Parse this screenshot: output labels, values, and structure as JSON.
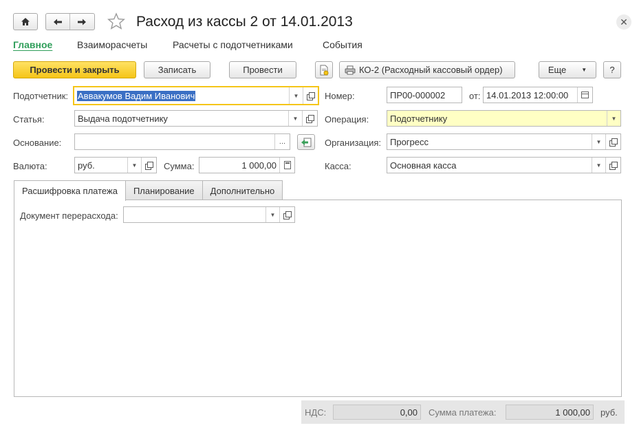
{
  "header": {
    "title": "Расход из кассы 2 от 14.01.2013"
  },
  "nav_tabs": [
    {
      "label": "Главное"
    },
    {
      "label": "Взаиморасчеты"
    },
    {
      "label": "Расчеты с подотчетниками"
    },
    {
      "label": "События"
    }
  ],
  "toolbar": {
    "post_close": "Провести и закрыть",
    "save": "Записать",
    "post": "Провести",
    "print": "КО-2 (Расходный кассовый ордер)",
    "more": "Еще",
    "help": "?"
  },
  "form": {
    "employee_label": "Подотчетник:",
    "employee_value": "Аввакумов Вадим Иванович",
    "article_label": "Статья:",
    "article_value": "Выдача подотчетнику",
    "basis_label": "Основание:",
    "basis_value": "",
    "currency_label": "Валюта:",
    "currency_value": "руб.",
    "sum_label": "Сумма:",
    "sum_value": "1 000,00",
    "number_label": "Номер:",
    "number_value": "ПР00-000002",
    "date_label": "от:",
    "date_value": "14.01.2013 12:00:00",
    "operation_label": "Операция:",
    "operation_value": "Подотчетнику",
    "org_label": "Организация:",
    "org_value": "Прогресс",
    "cashbox_label": "Касса:",
    "cashbox_value": "Основная касса"
  },
  "inner_tabs": [
    {
      "label": "Расшифровка платежа"
    },
    {
      "label": "Планирование"
    },
    {
      "label": "Дополнительно"
    }
  ],
  "payment": {
    "overspend_label": "Документ перерасхода:",
    "overspend_value": ""
  },
  "footer": {
    "vat_label": "НДС:",
    "vat_value": "0,00",
    "total_label": "Сумма платежа:",
    "total_value": "1 000,00",
    "currency": "руб."
  }
}
